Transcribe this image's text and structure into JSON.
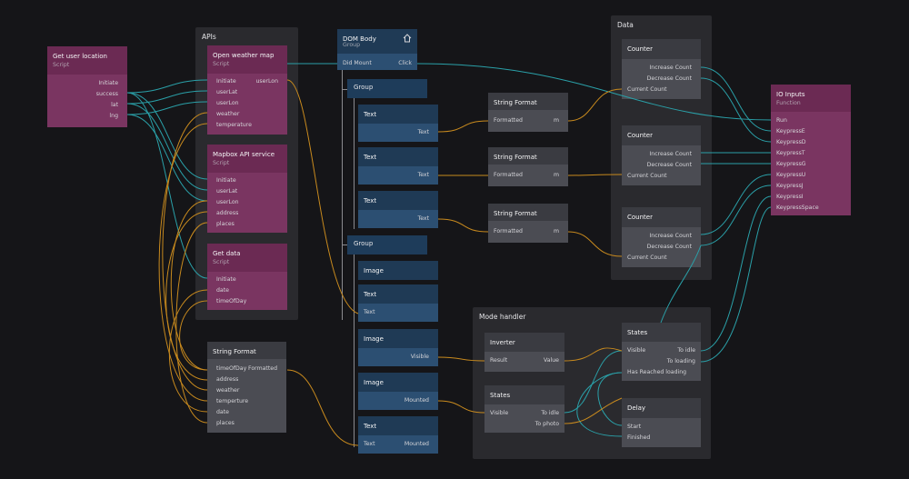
{
  "groups": {
    "apis": "APIs",
    "data": "Data",
    "mode_handler": "Mode handler"
  },
  "nodes": {
    "get_user_location": {
      "title": "Get user location",
      "subtitle": "Script",
      "ports": [
        "Initiate",
        "success",
        "lat",
        "lng"
      ]
    },
    "open_weather_map": {
      "title": "Open weather map",
      "subtitle": "Script",
      "inputs": [
        "Initiate",
        "userLat",
        "userLon",
        "weather",
        "temperature"
      ],
      "output": "userLon"
    },
    "mapbox_api": {
      "title": "Mapbox API service",
      "subtitle": "Script",
      "inputs": [
        "Initiate",
        "userLat",
        "userLon",
        "address",
        "places"
      ]
    },
    "get_data": {
      "title": "Get data",
      "subtitle": "Script",
      "inputs": [
        "Initiate",
        "date",
        "timeOfDay"
      ]
    },
    "string_format_main": {
      "title": "String Format",
      "inputs": [
        "timeOfDay",
        "address",
        "weather",
        "temperture",
        "date",
        "places"
      ],
      "output": "Formatted"
    },
    "dom_body": {
      "title": "DOM Body",
      "subtitle": "Group",
      "input": "Did Mount",
      "output": "Click"
    },
    "group1": "Group",
    "group2": "Group",
    "text1": {
      "title": "Text",
      "port": "Text"
    },
    "text2": {
      "title": "Text",
      "port": "Text"
    },
    "text3": {
      "title": "Text",
      "port": "Text"
    },
    "image1": {
      "title": "Image"
    },
    "text4": {
      "title": "Text",
      "port": "Text"
    },
    "image2": {
      "title": "Image",
      "port": "Visible"
    },
    "image3": {
      "title": "Image",
      "port": "Mounted"
    },
    "text5": {
      "title": "Text",
      "in_port": "Text",
      "out_port": "Mounted"
    },
    "string_format_1": {
      "title": "String Format",
      "input": "Formatted",
      "output": "m"
    },
    "string_format_2": {
      "title": "String Format",
      "input": "Formatted",
      "output": "m"
    },
    "string_format_3": {
      "title": "String Format",
      "input": "Formatted",
      "output": "m"
    },
    "counter1": {
      "title": "Counter",
      "ports": [
        "Increase Count",
        "Decrease Count",
        "Current Count"
      ]
    },
    "counter2": {
      "title": "Counter",
      "ports": [
        "Increase Count",
        "Decrease Count",
        "Current Count"
      ]
    },
    "counter3": {
      "title": "Counter",
      "ports": [
        "Increase Count",
        "Decrease Count",
        "Current Count"
      ]
    },
    "io_inputs": {
      "title": "IO Inputs",
      "subtitle": "Function",
      "ports": [
        "Run",
        "KeypressE",
        "KeypressD",
        "KeypressT",
        "KeypressG",
        "KeypressU",
        "KeypressJ",
        "KeypressI",
        "KeypressSpace"
      ]
    },
    "inverter": {
      "title": "Inverter",
      "input": "Result",
      "output": "Value"
    },
    "states1": {
      "title": "States",
      "input": "Visible",
      "outputs": [
        "To idle",
        "To photo"
      ]
    },
    "states2": {
      "title": "States",
      "input": "Visible",
      "outputs": [
        "To idle",
        "To loading"
      ],
      "extra": "Has Reached loading"
    },
    "delay": {
      "title": "Delay",
      "inputs": [
        "Start",
        "Finished"
      ]
    }
  },
  "colors": {
    "background": "#151518",
    "group_bg": "#2a2a2e",
    "script_header": "#6b2a53",
    "script_body": "#7a3561",
    "component_header": "#1f3a55",
    "component_body": "#2c4f72",
    "gray_header": "#3a3b41",
    "gray_body": "#4b4c53",
    "wire_teal": "#2aa0a8",
    "wire_orange": "#c88a1e"
  }
}
